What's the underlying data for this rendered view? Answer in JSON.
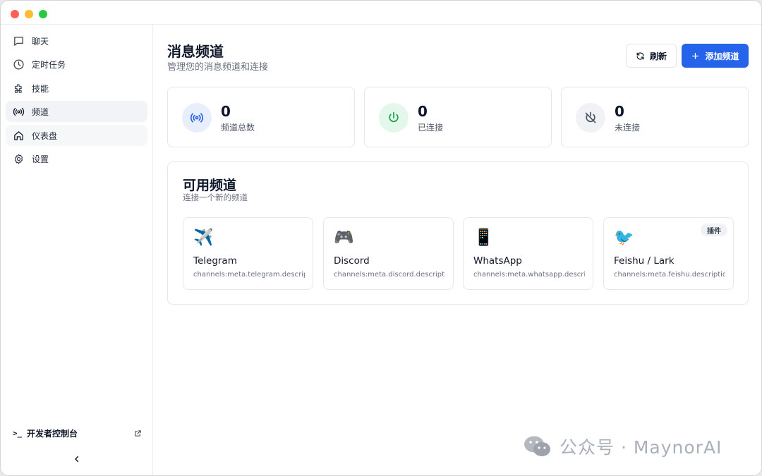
{
  "sidebar": {
    "items": [
      {
        "label": "聊天",
        "icon": "chat-bubble-icon"
      },
      {
        "label": "定时任务",
        "icon": "clock-icon"
      },
      {
        "label": "技能",
        "icon": "puzzle-icon"
      },
      {
        "label": "频道",
        "icon": "radio-broadcast-icon",
        "active": true
      },
      {
        "label": "仪表盘",
        "icon": "home-icon"
      },
      {
        "label": "设置",
        "icon": "gear-icon"
      }
    ],
    "dev_console": {
      "prompt": ">_",
      "label": "开发者控制台",
      "icon": "external-link-icon"
    },
    "collapse_icon": "chevron-left-icon"
  },
  "header": {
    "title": "消息频道",
    "subtitle": "管理您的消息频道和连接",
    "refresh_label": "刷新",
    "add_label": "添加频道"
  },
  "stats": [
    {
      "value": "0",
      "label": "频道总数",
      "icon": "radio-broadcast-icon",
      "color": "#2563eb",
      "bg": "#e8eefb"
    },
    {
      "value": "0",
      "label": "已连接",
      "icon": "power-icon",
      "color": "#16a34a",
      "bg": "#e3f8ea"
    },
    {
      "value": "0",
      "label": "未连接",
      "icon": "power-off-icon",
      "color": "#4b5563",
      "bg": "#f1f2f5"
    }
  ],
  "available": {
    "title": "可用频道",
    "subtitle": "连接一个新的频道",
    "channels": [
      {
        "emoji": "✈️",
        "name": "Telegram",
        "desc": "channels:meta.telegram.description"
      },
      {
        "emoji": "🎮",
        "name": "Discord",
        "desc": "channels:meta.discord.description"
      },
      {
        "emoji": "📱",
        "name": "WhatsApp",
        "desc": "channels:meta.whatsapp.description"
      },
      {
        "emoji": "🐦",
        "name": "Feishu / Lark",
        "desc": "channels:meta.feishu.description",
        "badge": "插件"
      }
    ]
  },
  "watermark": {
    "text": "公众号 · MaynorAI",
    "icon": "wechat-icon"
  },
  "colors": {
    "accent": "#2563eb",
    "active_nav": "#f1f3f7"
  }
}
